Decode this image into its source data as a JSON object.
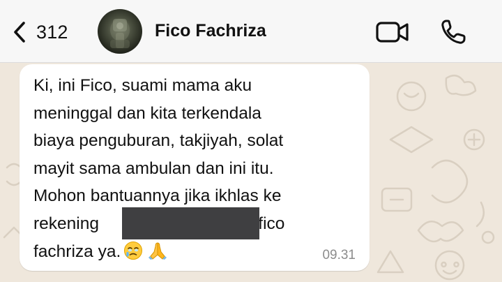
{
  "header": {
    "back_count": "312",
    "contact_name": "Fico Fachriza",
    "background_color": "#f7f7f7"
  },
  "icons": {
    "back": "chevron-left-icon",
    "video": "video-camera-icon",
    "call": "phone-icon",
    "avatar": "profile-photo"
  },
  "chat": {
    "wallpaper_color": "#efe7dc",
    "bubble_color": "#ffffff"
  },
  "message": {
    "lines": [
      "Ki, ini Fico, suami mama aku",
      "meninggal dan kita terkendala",
      "biaya penguburan, takjiyah, solat",
      "mayit sama ambulan dan ini itu.",
      "Mohon bantuannya jika ikhlas ke",
      "rekening",
      "fachriza ya."
    ],
    "line6_tail": "oca fico",
    "emojis": [
      "face-holding-back-tears",
      "folded-hands"
    ],
    "time": "09.31",
    "redaction_color": "#3f3f41"
  }
}
